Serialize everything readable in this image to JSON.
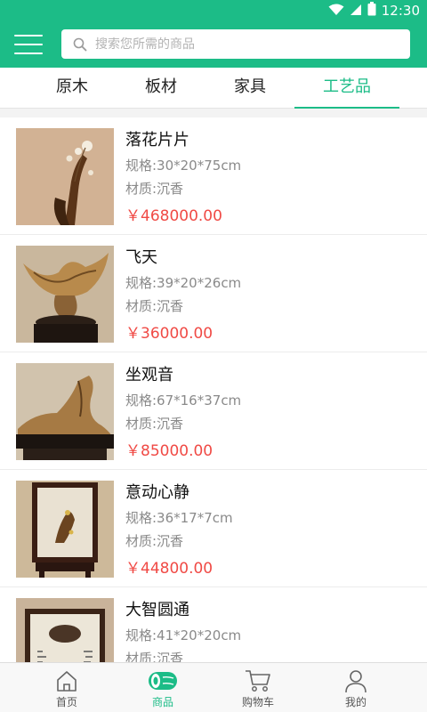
{
  "status_bar": {
    "time": "12:30"
  },
  "search": {
    "placeholder": "搜索您所需的商品"
  },
  "tabs": [
    {
      "label": "原木",
      "active": false
    },
    {
      "label": "板材",
      "active": false
    },
    {
      "label": "家具",
      "active": false
    },
    {
      "label": "工艺品",
      "active": true
    }
  ],
  "products": [
    {
      "name": "落花片片",
      "spec": "规格:30*20*75cm",
      "material": "材质:沉香",
      "price": "￥468000.00",
      "image": "agarwood-carving-flowers"
    },
    {
      "name": "飞天",
      "spec": "规格:39*20*26cm",
      "material": "材质:沉香",
      "price": "￥36000.00",
      "image": "agarwood-sculpture-on-stand"
    },
    {
      "name": "坐观音",
      "spec": "规格:67*16*37cm",
      "material": "材质:沉香",
      "price": "￥85000.00",
      "image": "agarwood-guanyin-carving"
    },
    {
      "name": "意动心静",
      "spec": "规格:36*17*7cm",
      "material": "材质:沉香",
      "price": "￥44800.00",
      "image": "framed-agarwood-screen"
    },
    {
      "name": "大智圆通",
      "spec": "规格:41*20*20cm",
      "material": "材质:沉香",
      "price": "",
      "image": "table-screen-calligraphy"
    }
  ],
  "bottom_nav": [
    {
      "label": "首页",
      "icon": "home-icon",
      "active": false
    },
    {
      "label": "商品",
      "icon": "goods-icon",
      "active": true
    },
    {
      "label": "购物车",
      "icon": "cart-icon",
      "active": false
    },
    {
      "label": "我的",
      "icon": "profile-icon",
      "active": false
    }
  ],
  "colors": {
    "primary": "#1cbc87",
    "price": "#f04a45",
    "muted_text": "#8a8a8a"
  }
}
